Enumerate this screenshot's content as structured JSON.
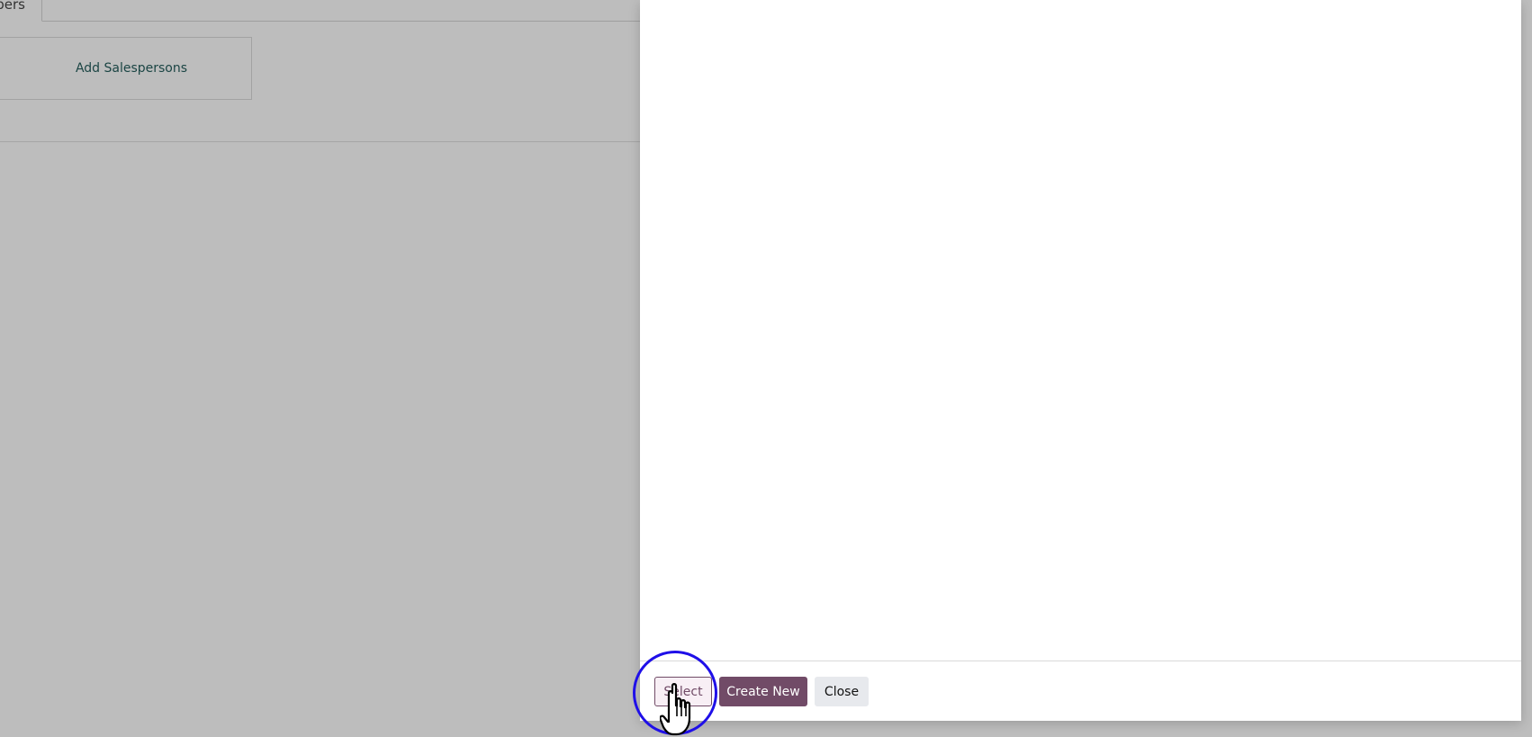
{
  "background_form": {
    "tab_label": "mbers",
    "add_salespersons_label": "Add Salespersons"
  },
  "dialog": {
    "footer": {
      "select_label": "Select",
      "create_new_label": "Create New",
      "close_label": "Close"
    }
  },
  "overlay": {
    "click_indicator_icon": "click-highlight-circle",
    "cursor_icon": "hand-pointer-icon",
    "ring_color": "#1f0fe8"
  },
  "colors": {
    "primary": "#714b67",
    "primary_light": "#f8eff5",
    "secondary_bg": "#e7e9ed",
    "backdrop": "#bdbdbd",
    "link_text": "#1b4544"
  }
}
